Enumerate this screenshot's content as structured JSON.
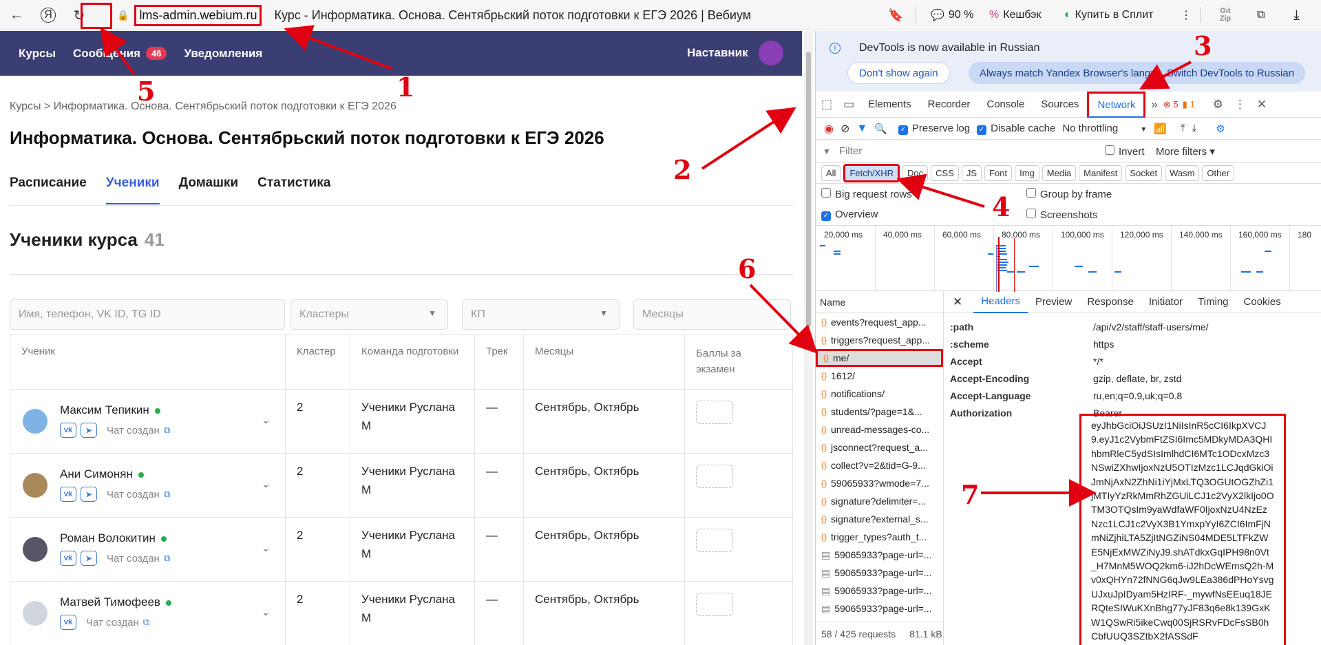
{
  "browser": {
    "url_host": "lms-admin.webium.ru",
    "page_title": "Курс - Информатика. Основа. Сентябрьский поток подготовки к ЕГЭ 2026 | Вебиум",
    "zoom": "90 %",
    "cashback": "Кешбэк",
    "split": "Купить в Сплит",
    "gitzip": "Git Zip"
  },
  "site": {
    "nav": {
      "courses": "Курсы",
      "messages": "Сообщения",
      "messages_badge": "46",
      "notifications": "Уведомления",
      "mentor": "Наставник"
    },
    "breadcrumb": "Курсы > Информатика. Основа. Сентябрьский поток подготовки к ЕГЭ 2026",
    "title": "Информатика. Основа. Сентябрьский поток подготовки к ЕГЭ 2026",
    "tabs": [
      "Расписание",
      "Ученики",
      "Домашки",
      "Статистика"
    ],
    "students_heading": "Ученики курса",
    "students_count": "41",
    "filters": {
      "search_placeholder": "Имя, телефон, VK ID, TG ID",
      "clusters": "Кластеры",
      "kp": "КП",
      "months": "Месяцы"
    },
    "columns": [
      "Ученик",
      "Кластер",
      "Команда подготовки",
      "Трек",
      "Месяцы",
      "Баллы за экзамен"
    ],
    "rows": [
      {
        "name": "Максим Тепикин",
        "cluster": "2",
        "team": "Ученики Руслана М",
        "track": "—",
        "months": "Сентябрь, Октябрь",
        "chat": "Чат создан"
      },
      {
        "name": "Ани Симонян",
        "cluster": "2",
        "team": "Ученики Руслана М",
        "track": "—",
        "months": "Сентябрь, Октябрь",
        "chat": "Чат создан"
      },
      {
        "name": "Роман Волокитин",
        "cluster": "2",
        "team": "Ученики Руслана М",
        "track": "—",
        "months": "Сентябрь, Октябрь",
        "chat": "Чат создан"
      },
      {
        "name": "Матвей Тимофеев",
        "cluster": "2",
        "team": "Ученики Руслана М",
        "track": "—",
        "months": "Сентябрь, Октябрь",
        "chat": "Чат создан"
      }
    ]
  },
  "devtools": {
    "info": "DevTools is now available in Russian",
    "btn_dont_show": "Don't show again",
    "btn_always": "Always match Yandex Browser's language",
    "btn_switch": "Switch DevTools to Russian",
    "tabs": [
      "Elements",
      "Recorder",
      "Console",
      "Sources",
      "Network"
    ],
    "errors": "5",
    "warnings": "1",
    "toolbar": {
      "preserve": "Preserve log",
      "disable_cache": "Disable cache",
      "throttle": "No throttling"
    },
    "filter_placeholder": "Filter",
    "invert": "Invert",
    "more_filters": "More filters",
    "types": [
      "All",
      "Fetch/XHR",
      "Doc",
      "CSS",
      "JS",
      "Font",
      "Img",
      "Media",
      "Manifest",
      "Socket",
      "Wasm",
      "Other"
    ],
    "opts": {
      "big": "Big request rows",
      "group": "Group by frame",
      "overview": "Overview",
      "screenshots": "Screenshots"
    },
    "timeline": [
      "20,000 ms",
      "40,000 ms",
      "60,000 ms",
      "80,000 ms",
      "100,000 ms",
      "120,000 ms",
      "140,000 ms",
      "160,000 ms",
      "180"
    ],
    "name_head": "Name",
    "requests": [
      "events?request_app...",
      "triggers?request_app...",
      "me/",
      "1612/",
      "notifications/",
      "students/?page=1&...",
      "unread-messages-co...",
      "jsconnect?request_a...",
      "collect?v=2&tid=G-9...",
      "59065933?wmode=7...",
      "signature?delimiter=...",
      "signature?external_s...",
      "trigger_types?auth_t...",
      "59065933?page-url=...",
      "59065933?page-url=...",
      "59065933?page-url=...",
      "59065933?page-url=..."
    ],
    "footer_requests": "58 / 425 requests",
    "footer_size": "81.1 kB",
    "detail_tabs": [
      "Headers",
      "Preview",
      "Response",
      "Initiator",
      "Timing",
      "Cookies"
    ],
    "headers": [
      {
        "k": ":path",
        "v": "/api/v2/staff/staff-users/me/"
      },
      {
        "k": ":scheme",
        "v": "https"
      },
      {
        "k": "Accept",
        "v": "*/*"
      },
      {
        "k": "Accept-Encoding",
        "v": "gzip, deflate, br, zstd"
      },
      {
        "k": "Accept-Language",
        "v": "ru,en;q=0.9,uk;q=0.8"
      },
      {
        "k": "Authorization",
        "v": "Bearer"
      }
    ],
    "token": "eyJhbGciOiJSUzI1NiIsInR5cCI6IkpXVCJ9.eyJ1c2VybmFtZSI6Imc5MDkyMDA3QHIhbmRleC5ydSIsImlhdCI6MTc1ODcxMzc3NSwiZXhwIjoxNzU5OTIzMzc1LCJqdGkiOiJmNjAxN2ZhNi1iYjMxLTQ3OGUtOGZhZi1jMTIyYzRkMmRhZGUiLCJ1c2VyX2lkIjo0OTM3OTQsIm9yaWdfaWF0IjoxNzU4NzEzNzc1LCJ1c2VyX3B1YmxpYyI6ZCI6ImFjNmNiZjhiLTA5ZjItNGZiNS04MDE5LTFkZWE5NjExMWZiNyJ9.shATdkxGqIPH98n0Vt_H7MnM5WOQ2km6-iJ2hDcWEmsQ2h-Mv0xQHYn72fNNG6qJw9LEa386dPHoYsvgUJxuJpIDyam5HzIRF-_mywfNsEEuq18JERQteSIWuKXnBhg77yJF83q6e8k139GxKW1QSwRi5ikeCwq00SjRSRvFDcFsSB0hCbfUUQ3SZtbX2fASSdF"
  },
  "annotations": [
    "1",
    "2",
    "3",
    "4",
    "5",
    "6",
    "7"
  ]
}
